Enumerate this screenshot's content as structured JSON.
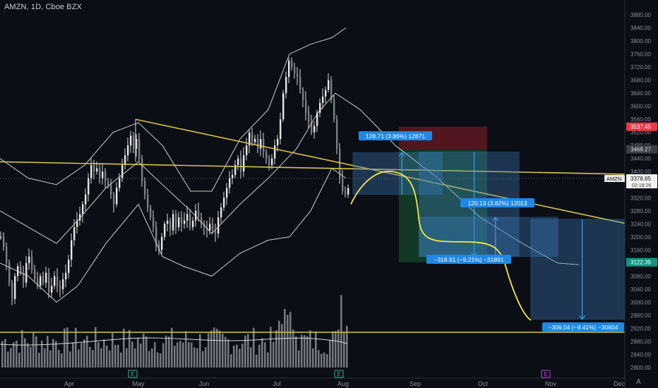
{
  "header": {
    "title": "AMZN, 1D, Cboe BZX"
  },
  "colors": {
    "background": "#0c0e15",
    "line": "#d8d8d8",
    "trend": "#d4c44b",
    "curve": "#f2ea4a",
    "measure_fill": "#3d7fbf",
    "measure_line": "#3ba0f0",
    "label_blue": "#1e88e5",
    "red_zone": "#8c1e2a",
    "green_zone": "#1c6e3b",
    "price_red": "#f23645",
    "price_green": "#089981"
  },
  "price_axis": {
    "min": 2800,
    "max": 3880,
    "step": 40,
    "labels": [
      "3880.00",
      "3840.00",
      "3800.00",
      "3760.00",
      "3720.00",
      "3680.00",
      "3640.00",
      "3600.00",
      "3560.00",
      "3520.00",
      "3480.00",
      "3440.00",
      "3400.00",
      "3360.00",
      "3320.00",
      "3280.00",
      "3240.00",
      "3200.00",
      "3160.00",
      "3120.00",
      "3080.00",
      "3040.00",
      "3000.00",
      "2960.00",
      "2920.00",
      "2880.00",
      "2840.00",
      "2800.00"
    ]
  },
  "time_axis": {
    "labels": [
      {
        "text": "Apr",
        "x": 98
      },
      {
        "text": "May",
        "x": 196
      },
      {
        "text": "Jun",
        "x": 289
      },
      {
        "text": "Jul",
        "x": 392
      },
      {
        "text": "Aug",
        "x": 486
      },
      {
        "text": "Sep",
        "x": 588
      },
      {
        "text": "Oct",
        "x": 684
      },
      {
        "text": "Nov",
        "x": 780
      },
      {
        "text": "Dec",
        "x": 877
      }
    ],
    "corner": "A"
  },
  "price_tags": {
    "red": {
      "price": "3537.45"
    },
    "gray": {
      "price": "3468.27"
    },
    "current": {
      "symbol": "AMZN",
      "price": "3378.85",
      "countdown": "02:18:26"
    },
    "green": {
      "price": "3122.39"
    }
  },
  "measure_labels": [
    {
      "text": "128.71 (3.86%) 12871"
    },
    {
      "text": "120.13 (3.82%) 12013"
    },
    {
      "text": "−318.91 (−9.21%) −31891"
    },
    {
      "text": "−306.04 (−9.41%) −30604"
    }
  ],
  "event_markers": [
    {
      "label": "E"
    },
    {
      "label": "E"
    },
    {
      "label": "E"
    }
  ],
  "chart_data": {
    "type": "line",
    "symbol": "AMZN",
    "interval": "1D",
    "exchange": "Cboe BZX",
    "title": "AMZN, 1D, Cboe BZX",
    "ylim": [
      2800,
      3880
    ],
    "x_tick_labels": [
      "Apr",
      "May",
      "Jun",
      "Jul",
      "Aug",
      "Sep",
      "Oct",
      "Nov",
      "Dec"
    ],
    "close_series": {
      "approx_daily_points": [
        [
          0,
          3200
        ],
        [
          4,
          3170
        ],
        [
          8,
          3120
        ],
        [
          12,
          3060
        ],
        [
          16,
          3010
        ],
        [
          20,
          3080
        ],
        [
          24,
          3110
        ],
        [
          28,
          3090
        ],
        [
          32,
          3060
        ],
        [
          36,
          3120
        ],
        [
          40,
          3140
        ],
        [
          44,
          3100
        ],
        [
          48,
          3070
        ],
        [
          52,
          3050
        ],
        [
          56,
          3080
        ],
        [
          60,
          3060
        ],
        [
          64,
          3090
        ],
        [
          68,
          3030
        ],
        [
          72,
          3050
        ],
        [
          76,
          3080
        ],
        [
          80,
          3050
        ],
        [
          84,
          3040
        ],
        [
          88,
          3070
        ],
        [
          92,
          3090
        ],
        [
          96,
          3130
        ],
        [
          100,
          3190
        ],
        [
          104,
          3230
        ],
        [
          108,
          3250
        ],
        [
          112,
          3270
        ],
        [
          116,
          3300
        ],
        [
          120,
          3330
        ],
        [
          124,
          3380
        ],
        [
          128,
          3420
        ],
        [
          132,
          3400
        ],
        [
          136,
          3410
        ],
        [
          140,
          3380
        ],
        [
          144,
          3400
        ],
        [
          148,
          3370
        ],
        [
          152,
          3360
        ],
        [
          156,
          3330
        ],
        [
          160,
          3300
        ],
        [
          164,
          3350
        ],
        [
          168,
          3380
        ],
        [
          172,
          3420
        ],
        [
          176,
          3450
        ],
        [
          180,
          3480
        ],
        [
          184,
          3510
        ],
        [
          188,
          3470
        ],
        [
          192,
          3500
        ],
        [
          196,
          3440
        ],
        [
          200,
          3370
        ],
        [
          204,
          3330
        ],
        [
          208,
          3290
        ],
        [
          212,
          3260
        ],
        [
          216,
          3230
        ],
        [
          220,
          3180
        ],
        [
          224,
          3160
        ],
        [
          228,
          3200
        ],
        [
          232,
          3240
        ],
        [
          236,
          3250
        ],
        [
          240,
          3220
        ],
        [
          244,
          3270
        ],
        [
          248,
          3230
        ],
        [
          252,
          3260
        ],
        [
          256,
          3240
        ],
        [
          260,
          3250
        ],
        [
          264,
          3270
        ],
        [
          268,
          3230
        ],
        [
          272,
          3250
        ],
        [
          276,
          3280
        ],
        [
          280,
          3260
        ],
        [
          284,
          3240
        ],
        [
          288,
          3230
        ],
        [
          292,
          3220
        ],
        [
          296,
          3240
        ],
        [
          300,
          3220
        ],
        [
          304,
          3210
        ],
        [
          308,
          3260
        ],
        [
          312,
          3290
        ],
        [
          316,
          3320
        ],
        [
          320,
          3350
        ],
        [
          324,
          3380
        ],
        [
          328,
          3390
        ],
        [
          332,
          3420
        ],
        [
          336,
          3440
        ],
        [
          340,
          3400
        ],
        [
          344,
          3450
        ],
        [
          348,
          3480
        ],
        [
          352,
          3520
        ],
        [
          356,
          3490
        ],
        [
          360,
          3500
        ],
        [
          364,
          3470
        ],
        [
          368,
          3500
        ],
        [
          372,
          3460
        ],
        [
          376,
          3440
        ],
        [
          380,
          3420
        ],
        [
          384,
          3440
        ],
        [
          388,
          3480
        ],
        [
          392,
          3500
        ],
        [
          396,
          3560
        ],
        [
          400,
          3640
        ],
        [
          404,
          3690
        ],
        [
          408,
          3740
        ],
        [
          412,
          3720
        ],
        [
          416,
          3700
        ],
        [
          420,
          3690
        ],
        [
          424,
          3650
        ],
        [
          428,
          3620
        ],
        [
          432,
          3580
        ],
        [
          436,
          3550
        ],
        [
          440,
          3520
        ],
        [
          444,
          3540
        ],
        [
          448,
          3580
        ],
        [
          452,
          3610
        ],
        [
          456,
          3630
        ],
        [
          460,
          3650
        ],
        [
          464,
          3680
        ],
        [
          468,
          3620
        ],
        [
          472,
          3560
        ],
        [
          476,
          3470
        ],
        [
          480,
          3380
        ],
        [
          484,
          3340
        ],
        [
          488,
          3330
        ],
        [
          492,
          3350
        ]
      ]
    },
    "bollinger": {
      "upper": [
        [
          0,
          3440
        ],
        [
          40,
          3380
        ],
        [
          80,
          3360
        ],
        [
          120,
          3420
        ],
        [
          160,
          3520
        ],
        [
          196,
          3550
        ],
        [
          230,
          3480
        ],
        [
          270,
          3340
        ],
        [
          300,
          3340
        ],
        [
          340,
          3500
        ],
        [
          380,
          3590
        ],
        [
          410,
          3760
        ],
        [
          440,
          3790
        ],
        [
          470,
          3810
        ],
        [
          490,
          3840
        ]
      ],
      "basis": [
        [
          0,
          3280
        ],
        [
          40,
          3230
        ],
        [
          80,
          3180
        ],
        [
          110,
          3250
        ],
        [
          150,
          3350
        ],
        [
          196,
          3430
        ],
        [
          230,
          3360
        ],
        [
          270,
          3280
        ],
        [
          300,
          3210
        ],
        [
          340,
          3300
        ],
        [
          380,
          3380
        ],
        [
          420,
          3470
        ],
        [
          450,
          3580
        ],
        [
          475,
          3640
        ],
        [
          510,
          3590
        ],
        [
          560,
          3480
        ],
        [
          620,
          3380
        ],
        [
          680,
          3260
        ],
        [
          740,
          3180
        ],
        [
          790,
          3120
        ],
        [
          820,
          3115
        ]
      ],
      "lower": [
        [
          0,
          3120
        ],
        [
          40,
          3080
        ],
        [
          80,
          3000
        ],
        [
          110,
          3050
        ],
        [
          150,
          3180
        ],
        [
          196,
          3300
        ],
        [
          230,
          3140
        ],
        [
          260,
          3110
        ],
        [
          300,
          3080
        ],
        [
          340,
          3150
        ],
        [
          380,
          3190
        ],
        [
          410,
          3200
        ],
        [
          440,
          3280
        ],
        [
          470,
          3410
        ],
        [
          490,
          3380
        ]
      ]
    },
    "trendlines": [
      {
        "from": [
          0,
          3430
        ],
        "to": [
          932,
          3390
        ]
      },
      {
        "from": [
          192,
          3560
        ],
        "to": [
          932,
          3220
        ]
      },
      {
        "from": [
          0,
          2908
        ],
        "to": [
          932,
          2908
        ]
      }
    ],
    "projection_curve": [
      [
        497,
        3300
      ],
      [
        520,
        3370
      ],
      [
        550,
        3395
      ],
      [
        580,
        3385
      ],
      [
        593,
        3280
      ],
      [
        600,
        3210
      ],
      [
        620,
        3185
      ],
      [
        660,
        3180
      ],
      [
        700,
        3170
      ],
      [
        720,
        3080
      ],
      [
        740,
        2990
      ],
      [
        752,
        2950
      ]
    ],
    "measurements": [
      {
        "change": 128.71,
        "percent": 3.86,
        "ticks": 12871,
        "from": 3330,
        "to": 3458
      },
      {
        "change": 120.13,
        "percent": 3.82,
        "ticks": 12013,
        "from": 3140,
        "to": 3260
      },
      {
        "change": -318.91,
        "percent": -9.21,
        "ticks": -31891,
        "from": 3460,
        "to": 3141
      },
      {
        "change": -306.04,
        "percent": -9.41,
        "ticks": -30604,
        "from": 3254,
        "to": 2948
      }
    ],
    "price_levels": {
      "stop": 3537.45,
      "entry": 3468.27,
      "last": 3378.85,
      "target": 3122.39
    },
    "volume_panel": true,
    "grid": false
  }
}
